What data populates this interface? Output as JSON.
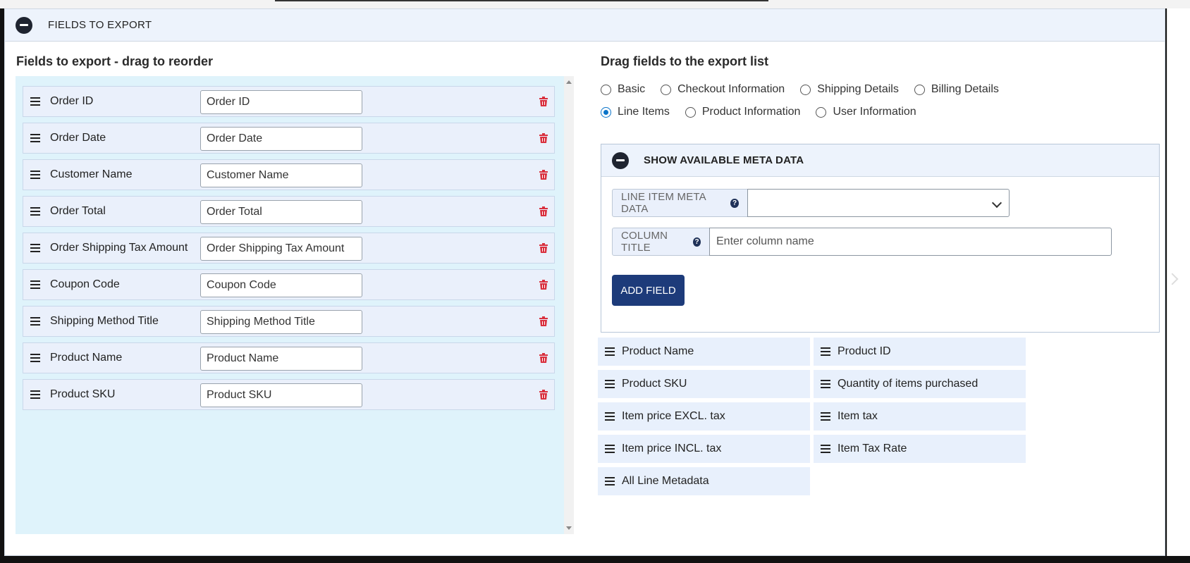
{
  "header": {
    "title": "FIELDS TO EXPORT",
    "toggle_icon": "minus-circle-icon"
  },
  "left": {
    "title": "Fields to export - drag to reorder",
    "fields": [
      {
        "label": "Order ID",
        "value": "Order ID"
      },
      {
        "label": "Order Date",
        "value": "Order Date"
      },
      {
        "label": "Customer Name",
        "value": "Customer Name"
      },
      {
        "label": "Order Total",
        "value": "Order Total"
      },
      {
        "label": "Order Shipping Tax Amount",
        "value": "Order Shipping Tax Amount"
      },
      {
        "label": "Coupon Code",
        "value": "Coupon Code"
      },
      {
        "label": "Shipping Method Title",
        "value": "Shipping Method Title"
      },
      {
        "label": "Product Name",
        "value": "Product Name"
      },
      {
        "label": "Product SKU",
        "value": "Product SKU"
      }
    ]
  },
  "right": {
    "title": "Drag fields to the export list",
    "radios": [
      {
        "label": "Basic",
        "checked": false
      },
      {
        "label": "Checkout Information",
        "checked": false
      },
      {
        "label": "Shipping Details",
        "checked": false
      },
      {
        "label": "Billing Details",
        "checked": false
      },
      {
        "label": "Line Items",
        "checked": true
      },
      {
        "label": "Product Information",
        "checked": false
      },
      {
        "label": "User Information",
        "checked": false
      }
    ],
    "meta": {
      "title": "SHOW AVAILABLE META DATA",
      "line_item_label": "LINE ITEM META DATA",
      "column_title_label": "COLUMN TITLE",
      "column_placeholder": "Enter column name",
      "add_button": "ADD FIELD"
    },
    "available": [
      "Product Name",
      "Product ID",
      "Product SKU",
      "Quantity of items purchased",
      "Item price EXCL. tax",
      "Item tax",
      "Item price INCL. tax",
      "Item Tax Rate",
      "All Line Metadata"
    ]
  },
  "colors": {
    "accent": "#1d3b7a",
    "delete": "#d9303e",
    "drop_area": "#dff3fb",
    "radio": "#0b74c9"
  }
}
